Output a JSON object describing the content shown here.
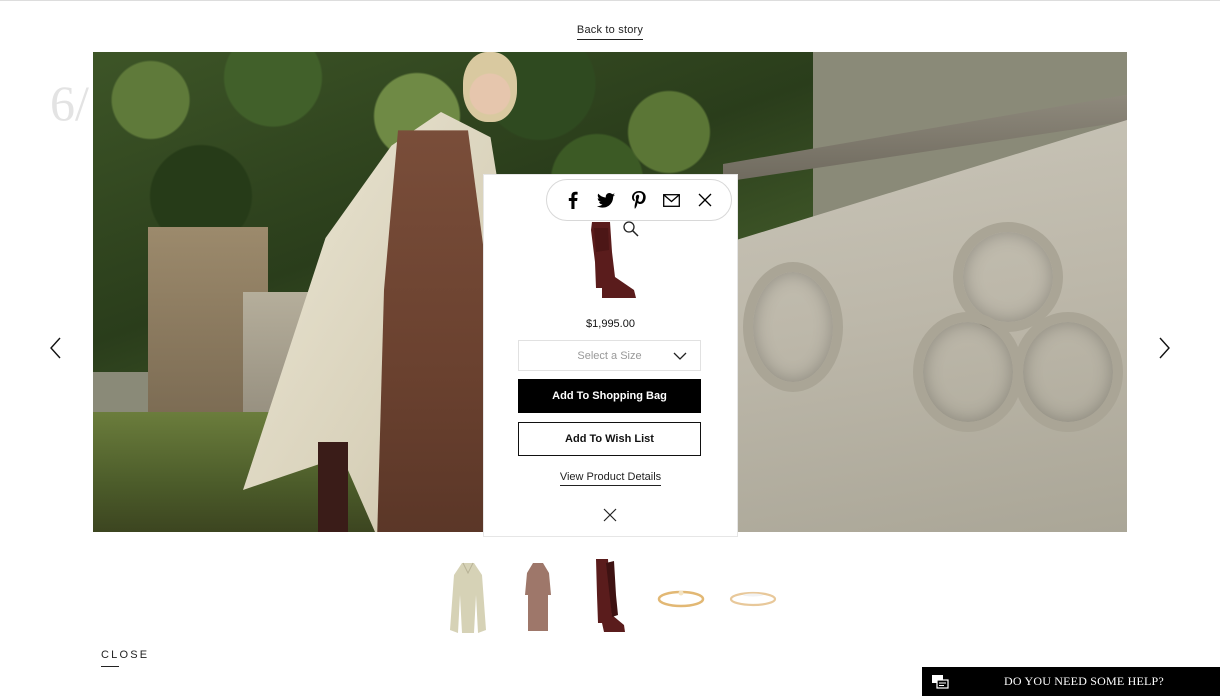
{
  "header": {
    "back_link": "Back to story"
  },
  "slide": {
    "number": "6/"
  },
  "share": {
    "icons": [
      "facebook-icon",
      "twitter-icon",
      "pinterest-icon",
      "email-icon",
      "close-icon"
    ]
  },
  "product": {
    "price": "$1,995.00",
    "size_placeholder": "Select a Size",
    "add_to_bag": "Add To Shopping Bag",
    "add_to_wishlist": "Add To Wish List",
    "view_details": "View Product Details"
  },
  "thumbnails": [
    "trench-coat",
    "knit-dress",
    "knee-boots",
    "gold-ring",
    "diamond-band"
  ],
  "footer": {
    "close_label": "CLOSE",
    "help_label": "DO YOU NEED SOME HELP?"
  }
}
